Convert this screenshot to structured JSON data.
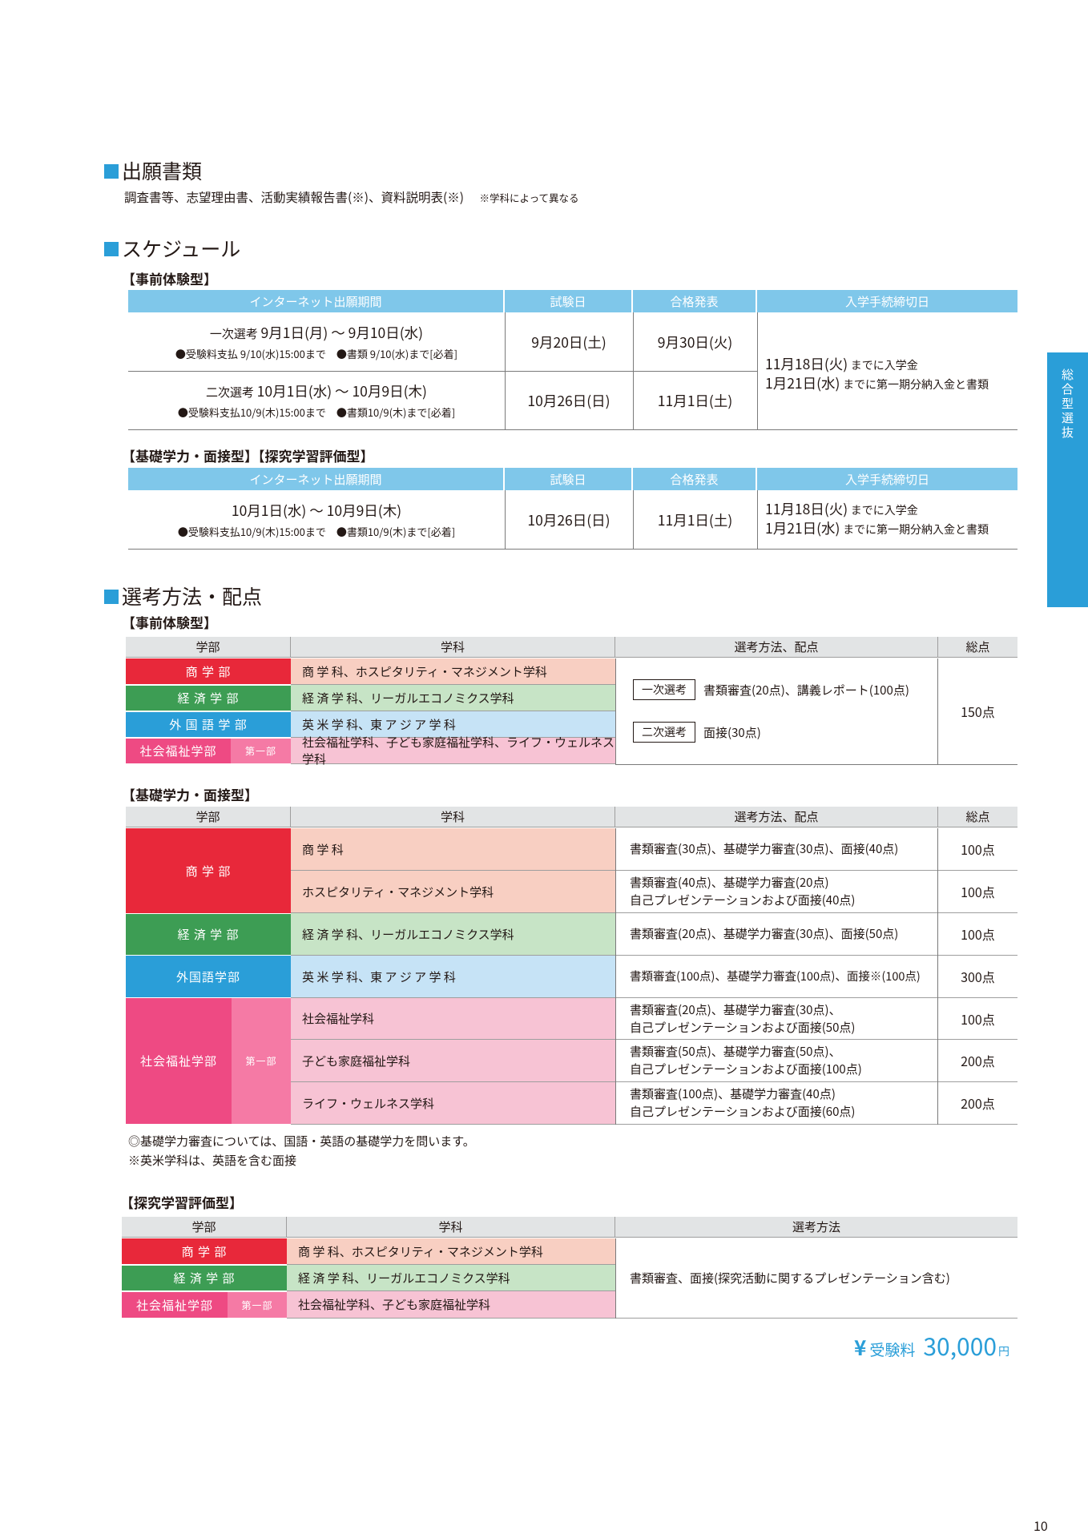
{
  "documents": {
    "title": "出願書類",
    "items": "調査書等、志望理由書、活動実績報告書(※)、資料説明表(※)",
    "note": "※学科によって異なる"
  },
  "schedule": {
    "title": "スケジュール",
    "headers": [
      "インターネット出願期間",
      "試験日",
      "合格発表",
      "入学手続締切日"
    ],
    "jizen": {
      "label": "【事前体験型】",
      "r1": {
        "label": "一次選考",
        "period": "9月1日(月) ～ 9月10日(水)",
        "pay": "●受験料支払 9/10(水)15:00まで",
        "docs": "●書類 9/10(水)まで[必着]",
        "exam": "9月20日(土)",
        "result": "9月30日(火)"
      },
      "r2": {
        "label": "二次選考",
        "period": "10月1日(水) ～ 10月9日(木)",
        "pay": "●受験料支払10/9(木)15:00まで",
        "docs": "●書類10/9(木)まで[必着]",
        "exam": "10月26日(日)",
        "result": "11月1日(土)"
      },
      "deadline1_date": "11月18日(火)",
      "deadline1_text": "までに入学金",
      "deadline2_date": "1月21日(水)",
      "deadline2_text": "までに第一期分納入金と書類"
    },
    "kiso": {
      "label": "【基礎学力・面接型】【探究学習評価型】",
      "period": "10月1日(水) ～ 10月9日(木)",
      "pay": "●受験料支払10/9(木)15:00まで",
      "docs": "●書類10/9(木)まで[必着]",
      "exam": "10月26日(日)",
      "result": "11月1日(土)",
      "deadline1_date": "11月18日(火)",
      "deadline1_text": "までに入学金",
      "deadline2_date": "1月21日(水)",
      "deadline2_text": "までに第一期分納入金と書類"
    }
  },
  "selection": {
    "title": "選考方法・配点",
    "headers": [
      "学部",
      "学科",
      "選考方法、配点",
      "総点"
    ],
    "headers3": [
      "学部",
      "学科",
      "選考方法"
    ],
    "jizen": {
      "label": "【事前体験型】",
      "rows": [
        {
          "faculty": "商 学 部",
          "dept": "商 学 科、ホスピタリティ・マネジメント学科"
        },
        {
          "faculty": "経 済 学 部",
          "dept": "経 済 学 科、リーガルエコノミクス学科"
        },
        {
          "faculty": "外 国 語 学 部",
          "dept": "英 米 学 科、東 ア ジ ア 学 科"
        },
        {
          "faculty": "社会福祉学部",
          "sub": "第一部",
          "dept": "社会福祉学科、子ども家庭福祉学科、ライフ・ウェルネス学科"
        }
      ],
      "stage1": "一次選考",
      "stage1_method": "書類審査(20点)、講義レポート(100点)",
      "stage2": "二次選考",
      "stage2_method": "面接(30点)",
      "total": "150点"
    },
    "kiso": {
      "label": "【基礎学力・面接型】",
      "fac1": "商 学 部",
      "fac2": "経 済 学 部",
      "fac3": "外国語学部",
      "fac4": "社会福祉学部",
      "fac4_sub": "第一部",
      "rows": [
        {
          "dept": "商 学 科",
          "m1": "書類審査(30点)、基礎学力審査(30点)、面接(40点)",
          "m2": "",
          "total": "100点"
        },
        {
          "dept": "ホスピタリティ・マネジメント学科",
          "m1": "書類審査(40点)、基礎学力審査(20点)",
          "m2": "自己プレゼンテーションおよび面接(40点)",
          "total": "100点"
        },
        {
          "dept": "経 済 学 科、リーガルエコノミクス学科",
          "m1": "書類審査(20点)、基礎学力審査(30点)、面接(50点)",
          "m2": "",
          "total": "100点"
        },
        {
          "dept": "英 米 学 科、東 ア ジ ア 学 科",
          "m1": "書類審査(100点)、基礎学力審査(100点)、面接※(100点)",
          "m2": "",
          "total": "300点"
        },
        {
          "dept": "社会福祉学科",
          "m1": "書類審査(20点)、基礎学力審査(30点)、",
          "m2": "自己プレゼンテーションおよび面接(50点)",
          "total": "100点"
        },
        {
          "dept": "子ども家庭福祉学科",
          "m1": "書類審査(50点)、基礎学力審査(50点)、",
          "m2": "自己プレゼンテーションおよび面接(100点)",
          "total": "200点"
        },
        {
          "dept": "ライフ・ウェルネス学科",
          "m1": "書類審査(100点)、基礎学力審査(40点)",
          "m2": "自己プレゼンテーションおよび面接(60点)",
          "total": "200点"
        }
      ],
      "note1": "◎基礎学力審査については、国語・英語の基礎学力を問います。",
      "note2": "※英米学科は、英語を含む面接"
    },
    "tankyu": {
      "label": "【探究学習評価型】",
      "rows": [
        {
          "faculty": "商 学 部",
          "dept": "商 学 科、ホスピタリティ・マネジメント学科"
        },
        {
          "faculty": "経 済 学 部",
          "dept": "経 済 学 科、リーガルエコノミクス学科"
        },
        {
          "faculty": "社会福祉学部",
          "sub": "第一部",
          "dept": "社会福祉学科、子ども家庭福祉学科"
        }
      ],
      "method": "書類審査、面接(探究活動に関するプレゼンテーション含む)"
    }
  },
  "fee": {
    "yen": "¥",
    "label": "受験料",
    "amount": "30,000",
    "unit": "円"
  },
  "side_tab": "総合型選抜",
  "page_number": "10",
  "colors": {
    "accent": "#2a9ed8",
    "commerce": "#e8283a",
    "economics": "#3d9d54",
    "foreign": "#2a9ed8",
    "welfare": "#ee4a83"
  }
}
